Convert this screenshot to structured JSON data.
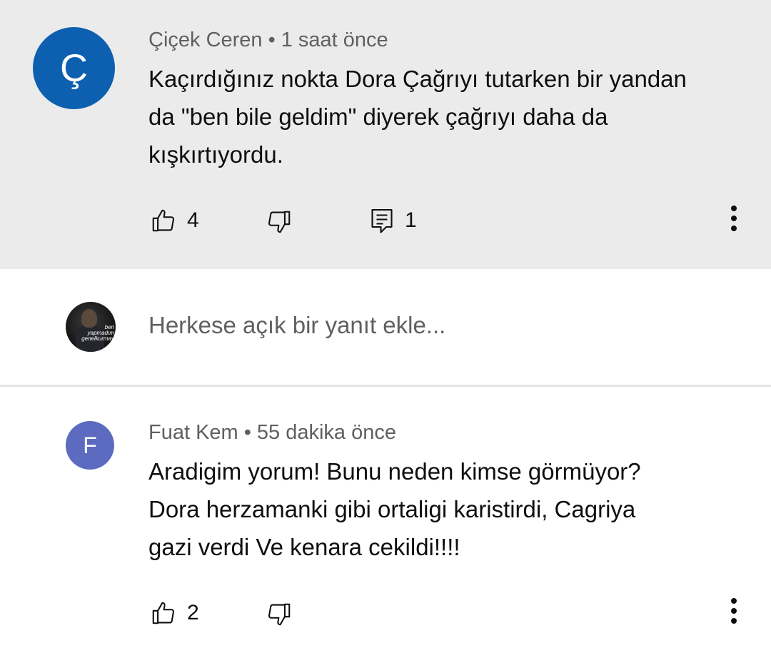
{
  "comments": [
    {
      "avatar_letter": "Ç",
      "avatar_color": "#0d5fb0",
      "author": "Çiçek Ceren",
      "separator": "•",
      "time": "1 saat önce",
      "lines": [
        "Kaçırdığınız nokta Dora Çağrıyı tutarken bir yandan",
        "da \"ben bile geldim\" diyerek çağrıyı daha da",
        "kışkırtıyordu."
      ],
      "likes": "4",
      "replies": "1",
      "highlight_color": "#ebebeb"
    },
    {
      "avatar_letter": "F",
      "avatar_color": "#5c6bc0",
      "author": "Fuat Kem",
      "separator": "•",
      "time": "55 dakika önce",
      "lines": [
        "Aradigim yorum! Bunu neden kimse görmüyor?",
        "Dora herzamanki gibi ortaligi karistirdi, Cagriya",
        "gazi verdi Ve kenara cekildi!!!!"
      ],
      "likes": "2"
    }
  ],
  "reply_box": {
    "placeholder": "Herkese açık bir yanıt ekle...",
    "avatar_caption": [
      "ben",
      "yapmadım",
      "genelkurmay"
    ]
  },
  "icons": {
    "like": "thumbs-up-icon",
    "dislike": "thumbs-down-icon",
    "reply": "comment-icon",
    "more": "more-vertical-icon"
  }
}
